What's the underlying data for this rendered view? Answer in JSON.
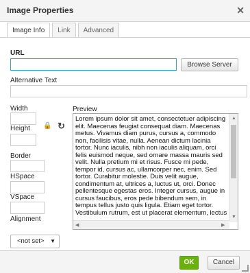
{
  "dialog": {
    "title": "Image Properties",
    "close_glyph": "✕"
  },
  "tabs": [
    {
      "label": "Image Info"
    },
    {
      "label": "Link"
    },
    {
      "label": "Advanced"
    }
  ],
  "fields": {
    "url_label": "URL",
    "url_value": "",
    "browse_label": "Browse Server",
    "alt_label": "Alternative Text",
    "alt_value": "",
    "width_label": "Width",
    "width_value": "",
    "height_label": "Height",
    "height_value": "",
    "border_label": "Border",
    "border_value": "",
    "hspace_label": "HSpace",
    "hspace_value": "",
    "vspace_label": "VSpace",
    "vspace_value": "",
    "alignment_label": "Alignment",
    "alignment_value": "<not set>",
    "lock_glyph": "🔒",
    "reset_glyph": "↻"
  },
  "preview": {
    "label": "Preview",
    "text": "Lorem ipsum dolor sit amet, consectetuer adipiscing\nelit. Maecenas feugiat consequat diam. Maecenas\nmetus. Vivamus diam purus, cursus a, commodo\nnon, facilisis vitae, nulla. Aenean dictum lacinia\ntortor. Nunc iaculis, nibh non iaculis aliquam, orci\nfelis euismod neque, sed ornare massa mauris sed\nvelit. Nulla pretium mi et risus. Fusce mi pede,\ntempor id, cursus ac, ullamcorper nec, enim. Sed\ntortor. Curabitur molestie. Duis velit augue,\ncondimentum at, ultrices a, luctus ut, orci. Donec\npellentesque egestas eros. Integer cursus, augue in\ncursus faucibus, eros pede bibendum sem, in\ntempus tellus justo quis ligula. Etiam eget tortor.\nVestibulum rutrum, est ut placerat elementum, lectus"
  },
  "footer": {
    "ok_label": "OK",
    "cancel_label": "Cancel"
  },
  "colors": {
    "ok_green": "#69b10b",
    "focus_blue": "#2aa6e1"
  }
}
